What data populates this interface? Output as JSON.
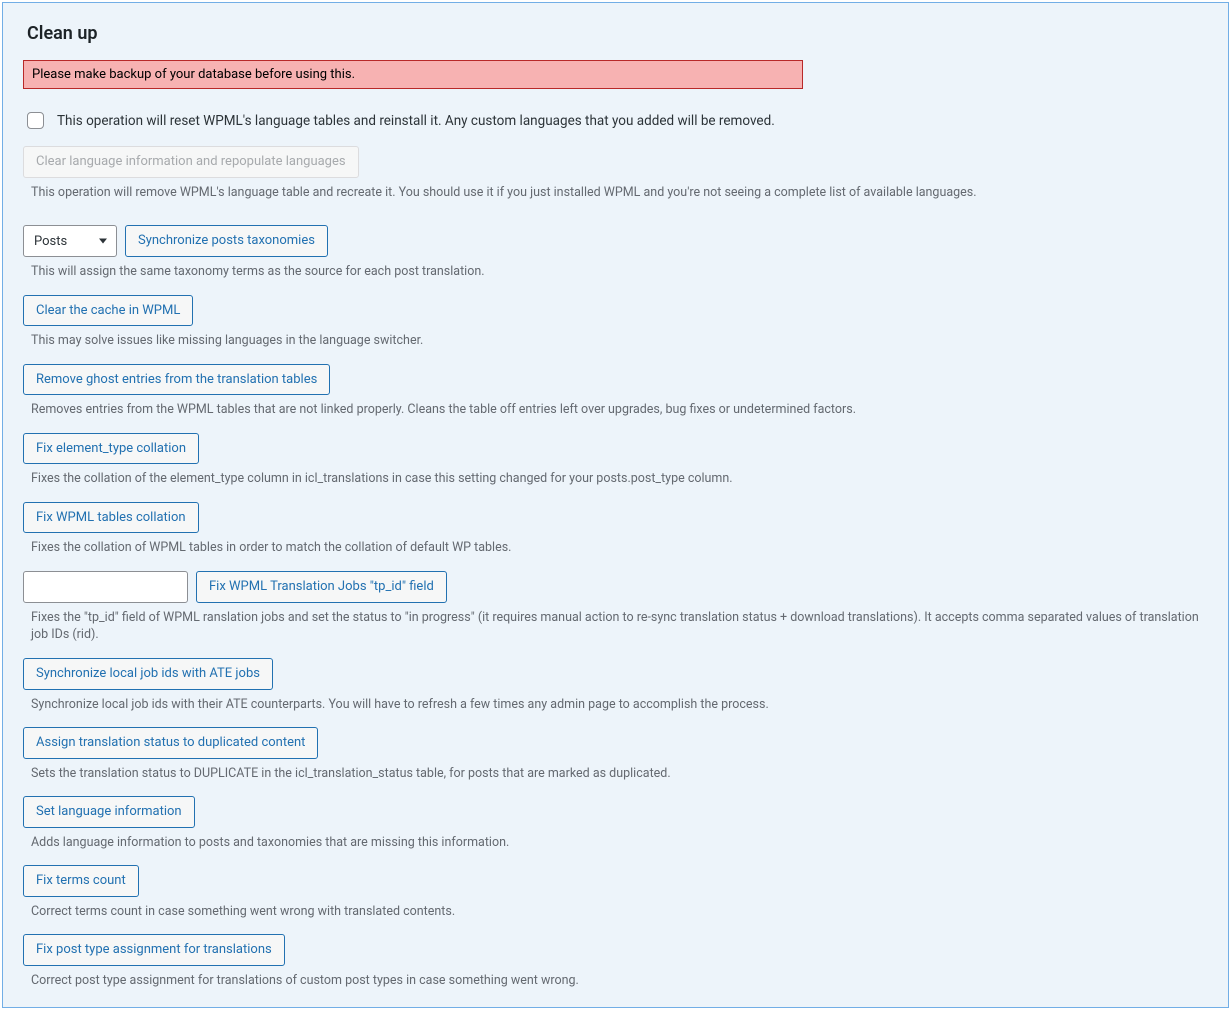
{
  "panel": {
    "title": "Clean up",
    "alert": "Please make backup of your database before using this.",
    "reset_checkbox_label": "This operation will reset WPML's language tables and reinstall it. Any custom languages that you added will be removed.",
    "clear_lang_btn": "Clear language information and repopulate languages",
    "clear_lang_desc": "This operation will remove WPML's language table and recreate it. You should use it if you just installed WPML and you're not seeing a complete list of available languages.",
    "post_type_selected": "Posts",
    "sync_tax_btn": "Synchronize posts taxonomies",
    "sync_tax_desc": "This will assign the same taxonomy terms as the source for each post translation.",
    "actions": [
      {
        "btn": "Clear the cache in WPML",
        "desc": "This may solve issues like missing languages in the language switcher."
      },
      {
        "btn": "Remove ghost entries from the translation tables",
        "desc": "Removes entries from the WPML tables that are not linked properly. Cleans the table off entries left over upgrades, bug fixes or undetermined factors."
      },
      {
        "btn": "Fix element_type collation",
        "desc": "Fixes the collation of the element_type column in icl_translations in case this setting changed for your posts.post_type column."
      },
      {
        "btn": "Fix WPML tables collation",
        "desc": "Fixes the collation of WPML tables in order to match the collation of default WP tables."
      }
    ],
    "fix_tpid_btn": "Fix WPML Translation Jobs \"tp_id\" field",
    "fix_tpid_desc": "Fixes the \"tp_id\" field of WPML ranslation jobs and set the status to \"in progress\" (it requires manual action to re-sync translation status + download translations). It accepts comma separated values of translation job IDs (rid).",
    "actions2": [
      {
        "btn": "Synchronize local job ids with ATE jobs",
        "desc": "Synchronize local job ids with their ATE counterparts. You will have to refresh a few times any admin page to accomplish the process."
      },
      {
        "btn": "Assign translation status to duplicated content",
        "desc": "Sets the translation status to DUPLICATE in the icl_translation_status table, for posts that are marked as duplicated."
      },
      {
        "btn": "Set language information",
        "desc": "Adds language information to posts and taxonomies that are missing this information."
      },
      {
        "btn": "Fix terms count",
        "desc": "Correct terms count in case something went wrong with translated contents."
      },
      {
        "btn": "Fix post type assignment for translations",
        "desc": "Correct post type assignment for translations of custom post types in case something went wrong."
      }
    ]
  }
}
